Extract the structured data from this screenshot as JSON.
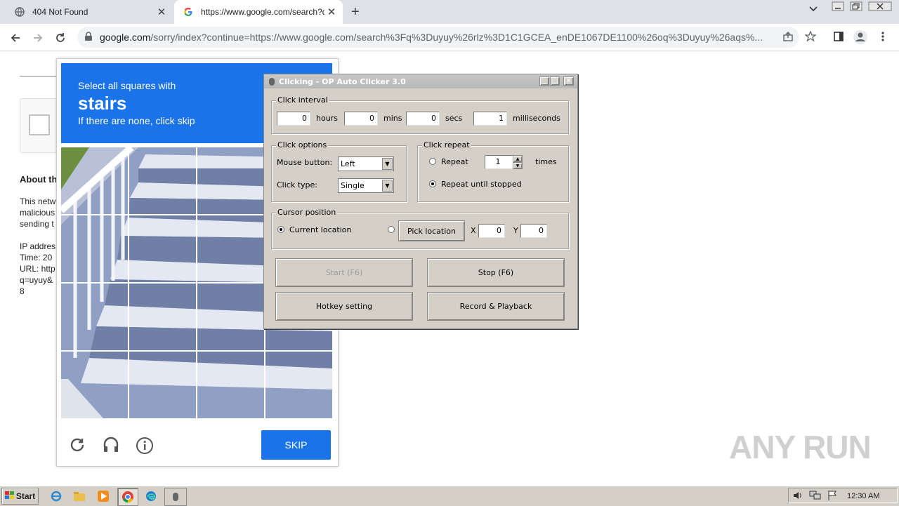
{
  "browser": {
    "tabs": [
      {
        "title": "404 Not Found"
      },
      {
        "title": "https://www.google.com/search?q="
      }
    ],
    "url_host": "google.com",
    "url_rest": "/sorry/index?continue=https://www.google.com/search%3Fq%3Duyuy%26rlz%3D1C1GCEA_enDE1067DE1100%26oq%3Duyuy%26aqs%..."
  },
  "page": {
    "about_heading": "About th",
    "lines": [
      "This netw",
      "malicious",
      "sending t",
      "",
      "IP addres",
      "Time: 20",
      "URL: http",
      "q=uyuy&",
      "8"
    ]
  },
  "captcha": {
    "instruction": "Select all squares with",
    "target": "stairs",
    "hint": "If there are none, click skip",
    "skip_label": "SKIP"
  },
  "clicker": {
    "title": "Clicking - OP Auto Clicker 3.0",
    "interval": {
      "label": "Click interval",
      "hours": "0",
      "hours_label": "hours",
      "mins": "0",
      "mins_label": "mins",
      "secs": "0",
      "secs_label": "secs",
      "ms": "1",
      "ms_label": "milliseconds"
    },
    "options": {
      "label": "Click options",
      "mouse_button_label": "Mouse button:",
      "mouse_button": "Left",
      "click_type_label": "Click type:",
      "click_type": "Single"
    },
    "repeat": {
      "label": "Click repeat",
      "repeat_label": "Repeat",
      "repeat_count": "1",
      "times_label": "times",
      "until_stopped_label": "Repeat until stopped"
    },
    "cursor": {
      "label": "Cursor position",
      "current_label": "Current location",
      "pick_label": "Pick location",
      "x_label": "X",
      "x": "0",
      "y_label": "Y",
      "y": "0"
    },
    "buttons": {
      "start": "Start (F6)",
      "stop": "Stop (F6)",
      "hotkey": "Hotkey setting",
      "record": "Record & Playback"
    }
  },
  "taskbar": {
    "start_label": "Start",
    "clock": "12:30 AM"
  },
  "watermark": "ANY RUN"
}
